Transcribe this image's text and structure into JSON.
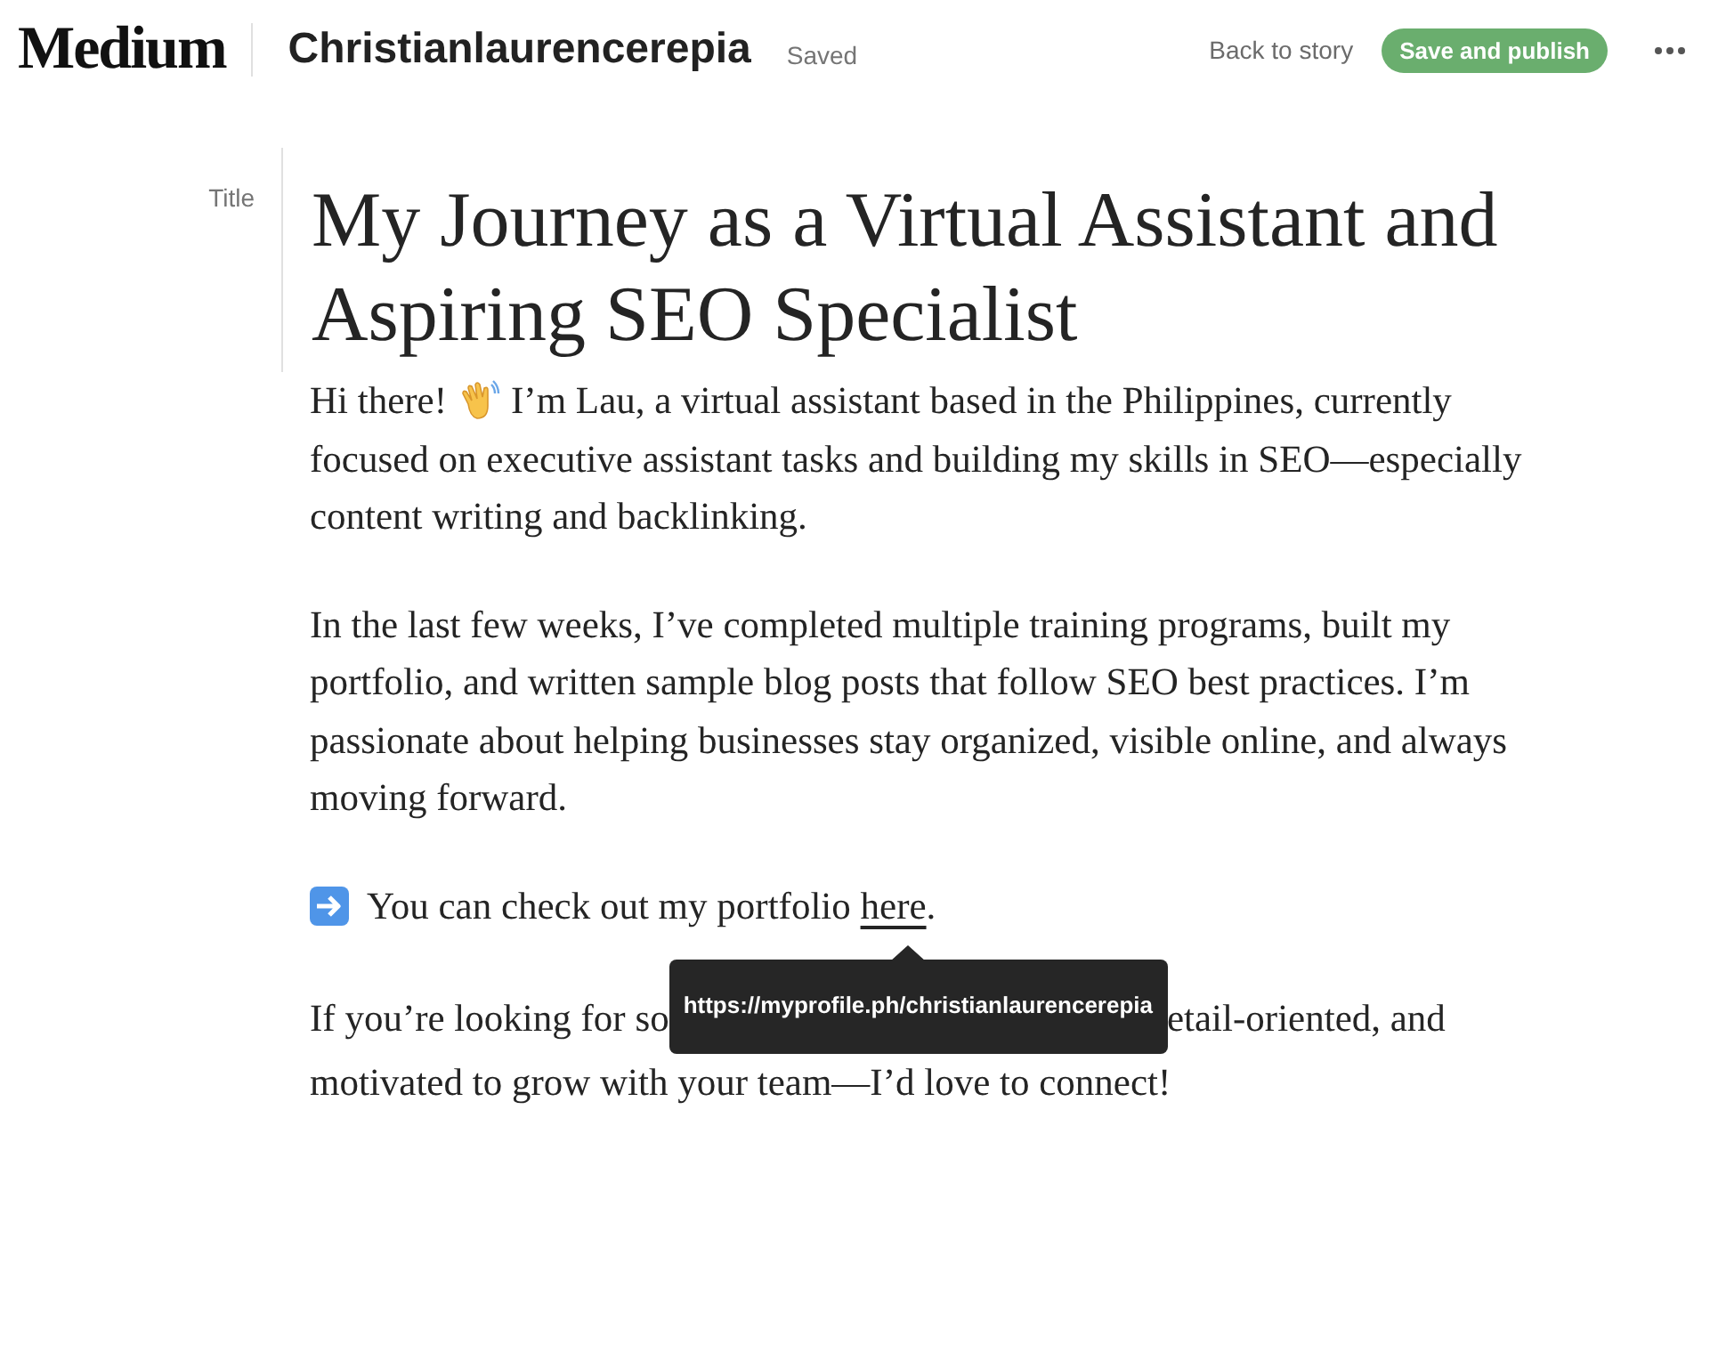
{
  "header": {
    "logo": "Medium",
    "author": "Christianlaurencerepia",
    "status": "Saved",
    "back_link": "Back to story",
    "publish_button": {
      "label": "Save and publish",
      "disabled": true
    }
  },
  "editor": {
    "title_label": "Title",
    "title": "My Journey as a Virtual Assistant and Aspiring SEO Specialist",
    "paragraphs": [
      {
        "kind": "greeting",
        "before": "Hi there!",
        "after": "I’m Lau, a virtual assistant based in the Philippines, currently",
        "rest": "focused on executive assistant tasks and building my skills in SEO—especially content writing and backlinking."
      },
      {
        "kind": "text",
        "text": "In the last few weeks, I’ve completed multiple training programs, built my portfolio, and written sample blog posts that follow SEO best practices. I’m passionate about helping businesses stay organized, visible online, and always moving forward."
      },
      {
        "kind": "link",
        "before": "You can check out my portfolio",
        "link": "here",
        "after": "."
      },
      {
        "kind": "covered",
        "before": "If you’re looking for so",
        "tooltip": "https://myprofile.ph/christianlaurencerepia",
        "after": "etail-oriented, and",
        "rest": "motivated to grow with your team—I’d love to connect!"
      }
    ]
  }
}
